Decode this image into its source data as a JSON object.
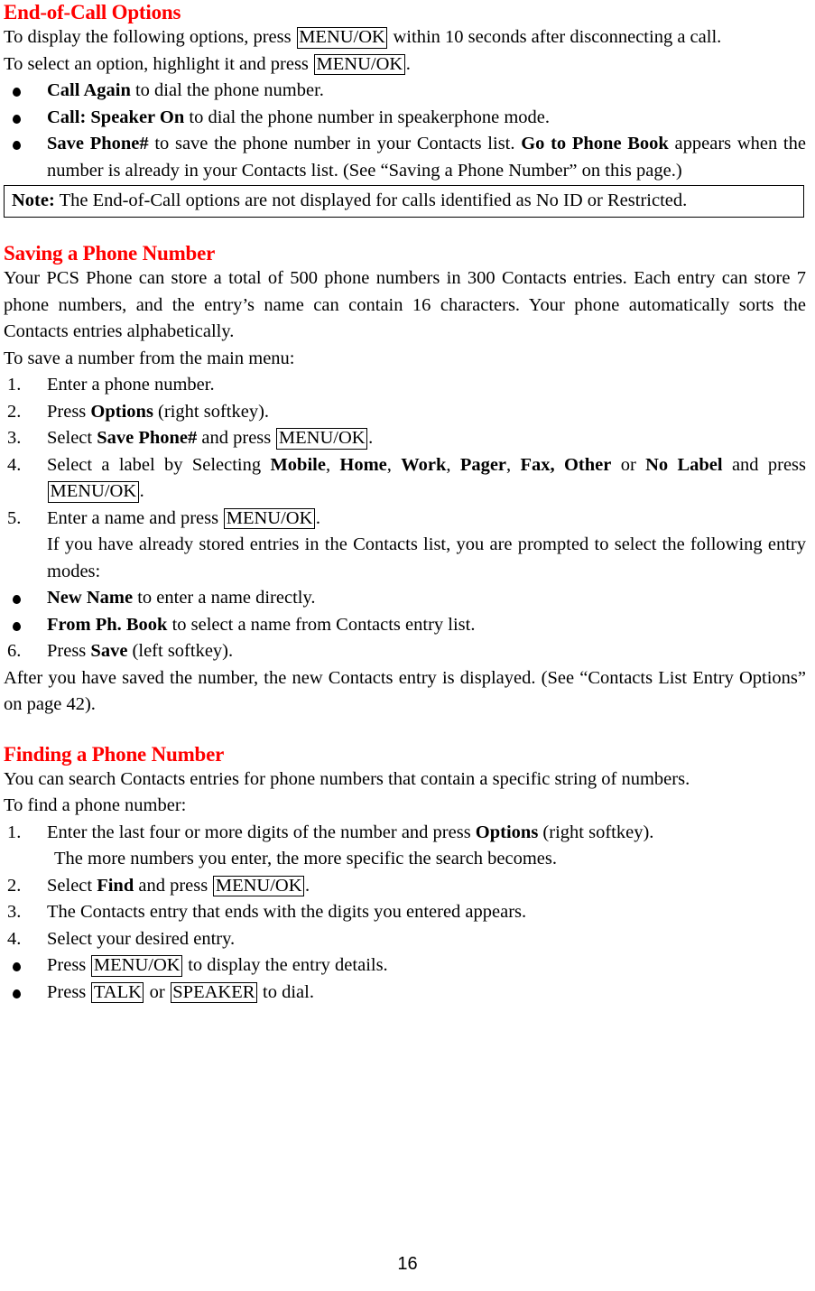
{
  "page": {
    "number": "16",
    "heading_color": "#ff0000",
    "text_color": "#000000",
    "background": "#ffffff"
  },
  "sections": [
    {
      "id": "end-of-call-options",
      "heading": "End-of-Call Options",
      "intro_line_1_a": "To display the following options, press ",
      "intro_line_1_key": "MENU/OK",
      "intro_line_1_b": " within 10 seconds after disconnecting a call.",
      "intro_line_2_a": "To select an option, highlight it and press ",
      "intro_line_2_key": "MENU/OK",
      "intro_line_2_b": ".",
      "bullets": [
        {
          "bold": "Call Again",
          "rest": " to dial the phone number."
        },
        {
          "bold": "Call: Speaker On",
          "rest": " to dial the phone number in speakerphone mode."
        },
        {
          "bold": "Save Phone#",
          "rest_a": " to save the phone number in your Contacts list. ",
          "bold_b": "Go to Phone Book",
          "rest_b": " appears when the number is already in your Contacts list. (See “Saving a Phone Number” on this page.)"
        }
      ],
      "note": {
        "label": "Note:",
        "text": " The End-of-Call options are not displayed for calls identified as No ID or Restricted."
      }
    },
    {
      "id": "saving-a-phone-number",
      "heading": "Saving a Phone Number",
      "paragraph": "Your PCS Phone can store a total of 500 phone numbers in 300 Contacts entries. Each entry can store 7 phone numbers, and the entry’s name can contain 16 characters. Your phone automatically sorts the Contacts entries alphabetically.",
      "lead_in": "To save a number from the main menu:",
      "steps": [
        {
          "num": "1.",
          "text": "Enter a phone number."
        },
        {
          "num": "2.",
          "pre": "Press ",
          "bold": "Options",
          "post": " (right softkey)."
        },
        {
          "num": "3.",
          "pre": "Select ",
          "bold": "Save Phone#",
          "mid": " and press ",
          "key": "MENU/OK",
          "post": "."
        },
        {
          "num": "4.",
          "pre": "Select a label by Selecting ",
          "labels": [
            "Mobile",
            "Home",
            "Work",
            "Pager",
            "Fax, Other"
          ],
          "conj": " or ",
          "last_label": "No Label",
          "mid": " and press ",
          "key": "MENU/OK",
          "post": "."
        },
        {
          "num": "5.",
          "pre": "Enter a name and press ",
          "key": "MENU/OK",
          "post": "."
        }
      ],
      "step5_note": "If you have already stored entries in the Contacts list, you are prompted to select the following entry modes:",
      "entry_mode_bullets": [
        {
          "bold": "New Name",
          "rest": " to enter a name directly."
        },
        {
          "bold": "From Ph. Book",
          "rest": " to select a name from Contacts entry list."
        }
      ],
      "step6": {
        "num": "6.",
        "pre": "Press ",
        "bold": "Save",
        "post": " (left softkey)."
      },
      "closing": "After you have saved the number, the new Contacts entry is displayed. (See “Contacts List Entry Options” on page 42)."
    },
    {
      "id": "finding-a-phone-number",
      "heading": "Finding a Phone Number",
      "paragraph": "You can search Contacts entries for phone numbers that contain a specific string of numbers.",
      "lead_in": "To find a phone number:",
      "steps": [
        {
          "num": "1.",
          "pre": "Enter the last four or more digits of the number and press ",
          "bold": "Options",
          "post": " (right softkey).",
          "sub": "The more numbers you enter, the more specific the search becomes."
        },
        {
          "num": "2.",
          "pre": "Select ",
          "bold": "Find",
          "mid": " and press ",
          "key": "MENU/OK",
          "post": "."
        },
        {
          "num": "3.",
          "text": "The Contacts entry that ends with the digits you entered appears."
        },
        {
          "num": "4.",
          "text": "Select your desired entry."
        }
      ],
      "bullets": [
        {
          "pre": "Press ",
          "key": "MENU/OK",
          "post": " to display the entry details."
        },
        {
          "pre": "Press ",
          "key": "TALK",
          "mid": " or ",
          "key2": "SPEAKER",
          "post": " to dial."
        }
      ]
    }
  ]
}
